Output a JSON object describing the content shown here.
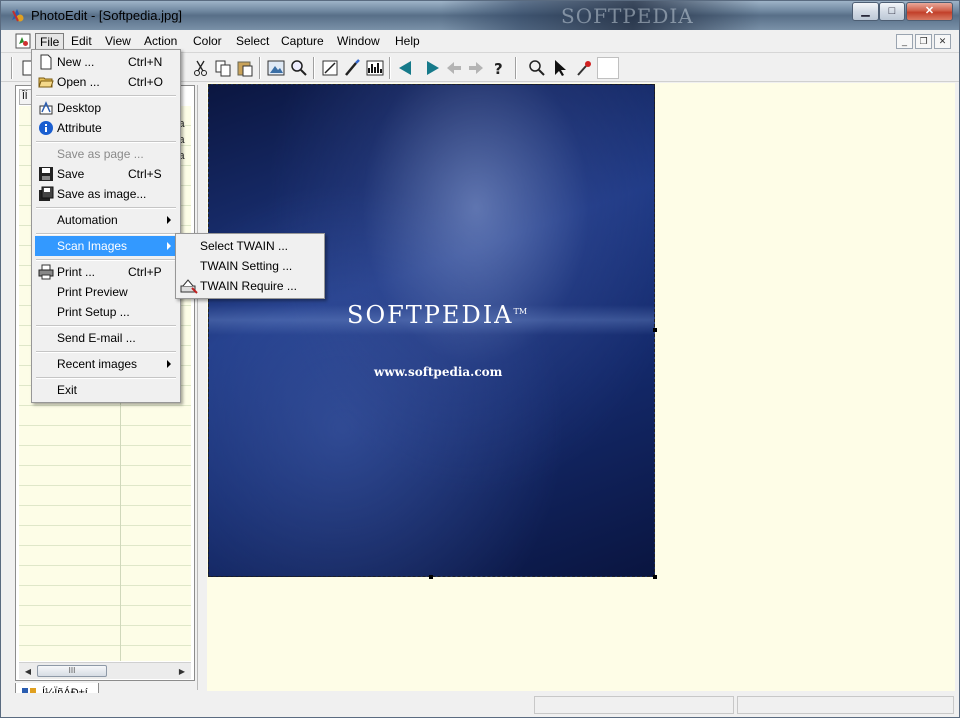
{
  "window": {
    "title": "PhotoEdit - [Softpedia.jpg]",
    "watermark": "SOFTPEDIA",
    "min_glyph": "▁",
    "max_glyph": "□",
    "close_glyph": "✕"
  },
  "menubar": {
    "items": [
      {
        "label": "File"
      },
      {
        "label": "Edit"
      },
      {
        "label": "View"
      },
      {
        "label": "Action"
      },
      {
        "label": "Color"
      },
      {
        "label": "Select"
      },
      {
        "label": "Capture"
      },
      {
        "label": "Window"
      },
      {
        "label": "Help"
      }
    ],
    "mdi": {
      "min": "_",
      "restore": "❐",
      "close": "✕"
    }
  },
  "file_menu": {
    "items": [
      {
        "label": "New ...",
        "shortcut": "Ctrl+N",
        "icon": "new-file-icon"
      },
      {
        "label": "Open ...",
        "shortcut": "Ctrl+O",
        "icon": "open-folder-icon"
      },
      {
        "label": "Desktop",
        "icon": "desktop-icon"
      },
      {
        "label": "Attribute",
        "icon": "info-icon"
      },
      {
        "label": "Save as page ...",
        "disabled": true
      },
      {
        "label": "Save",
        "shortcut": "Ctrl+S",
        "icon": "save-icon"
      },
      {
        "label": "Save as image...",
        "icon": "save-as-image-icon"
      },
      {
        "label": "Automation",
        "submenu": true
      },
      {
        "label": "Scan Images",
        "submenu": true,
        "highlighted": true
      },
      {
        "label": "Print ...",
        "shortcut": "Ctrl+P",
        "icon": "printer-icon"
      },
      {
        "label": "Print Preview"
      },
      {
        "label": "Print Setup ..."
      },
      {
        "label": "Send E-mail ..."
      },
      {
        "label": "Recent images",
        "submenu": true
      },
      {
        "label": "Exit"
      }
    ]
  },
  "scan_submenu": {
    "items": [
      {
        "label": "Select TWAIN ..."
      },
      {
        "label": "TWAIN Setting ..."
      },
      {
        "label": "TWAIN Require ...",
        "icon": "scanner-icon"
      }
    ]
  },
  "left_panel": {
    "header": "ÎÍ",
    "cells": [
      "ia",
      "ia",
      "ia"
    ],
    "tab_label": "Í¼ÏñÁÐ±í",
    "scroll_thumb": "III"
  },
  "image": {
    "brand": "SOFTPEDIA",
    "trademark": "TM",
    "url": "www.softpedia.com"
  },
  "colors": {
    "menu_highlight": "#3399ff",
    "canvas_bg": "#fefde7",
    "list_bg": "#fdfde7"
  }
}
